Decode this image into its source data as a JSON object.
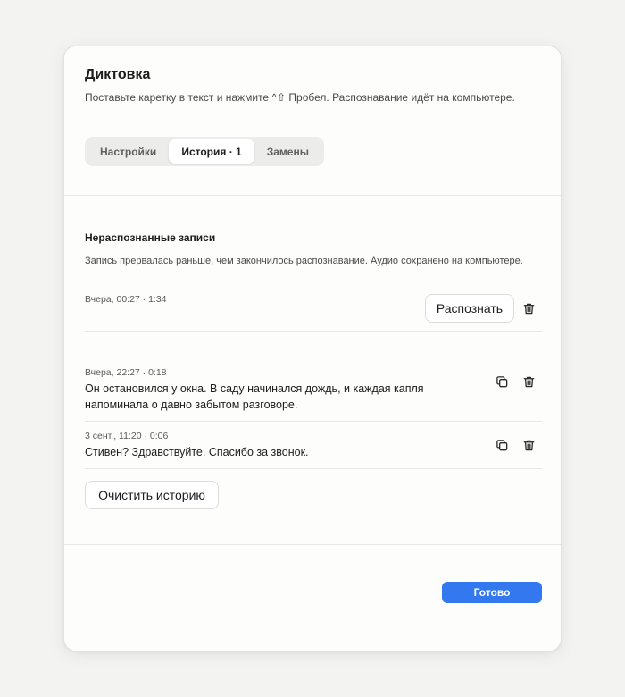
{
  "header": {
    "title": "Диктовка",
    "subtitle": "Поставьте каретку в текст и нажмите ^⇧ Пробел. Распознавание идёт на компьютере."
  },
  "tabs": [
    {
      "label": "Настройки",
      "active": false
    },
    {
      "label": "История · 1",
      "active": true
    },
    {
      "label": "Замены",
      "active": false
    }
  ],
  "unrecognized": {
    "title": "Нераспознанные записи",
    "description": "Запись прервалась раньше, чем закончилось распознавание. Аудио сохранено на компьютере.",
    "item": {
      "meta": "Вчера, 00:27 · 1:34",
      "recognize_label": "Распознать",
      "delete_icon": "trash-icon"
    }
  },
  "history": [
    {
      "meta": "Вчера, 22:27 · 0:18",
      "text": "Он остановился у окна. В саду начинался дождь, и каждая капля напоминала о давно забытом разговоре.",
      "copy_icon": "copy-icon",
      "delete_icon": "trash-icon"
    },
    {
      "meta": "3 сент., 11:20 · 0:06",
      "text": "Стивен? Здравствуйте. Спасибо за звонок.",
      "copy_icon": "copy-icon",
      "delete_icon": "trash-icon"
    }
  ],
  "clear_history_label": "Очистить историю",
  "footer": {
    "done_label": "Готово"
  },
  "colors": {
    "accent": "#3478f0",
    "background": "#f3f3f2",
    "panel": "#fdfdfc"
  }
}
